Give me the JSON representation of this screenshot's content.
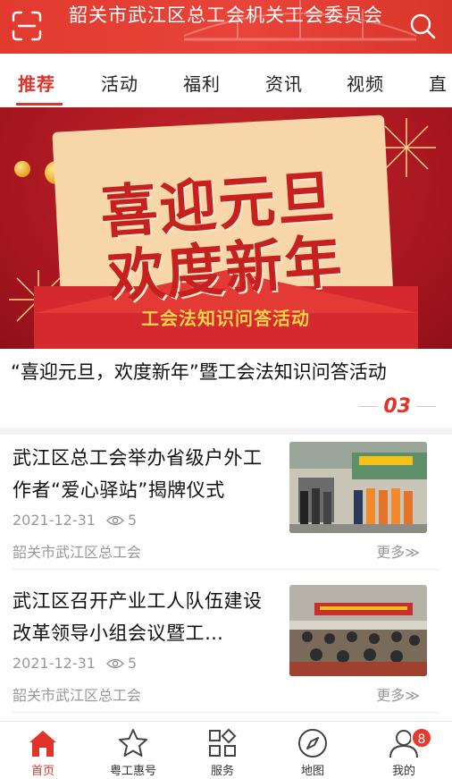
{
  "header": {
    "title": "韶关市武江区总工会机关工会委员会",
    "bg_color": "#e23a2e",
    "left_icon": "scan-icon",
    "right_icon": "search-icon"
  },
  "tabs": [
    {
      "label": "推荐",
      "active": true
    },
    {
      "label": "活动",
      "active": false
    },
    {
      "label": "福利",
      "active": false
    },
    {
      "label": "资讯",
      "active": false
    },
    {
      "label": "视频",
      "active": false
    },
    {
      "label": "直",
      "active": false
    }
  ],
  "banner": {
    "line1": "喜迎元旦",
    "line2": "欢度新年",
    "subtitle": "工会法知识问答活动",
    "caption": "“喜迎元旦，欢度新年”暨工会法知识问答活动",
    "page": "03"
  },
  "news": [
    {
      "title": "武江区总工会举办省级户外工作者“爱心驿站”揭牌仪式",
      "date": "2021-12-31",
      "views": "5",
      "source": "韶关市武江区总工会",
      "more": "更多"
    },
    {
      "title": "武江区召开产业工人队伍建设改革领导小组会议暨工…",
      "date": "2021-12-31",
      "views": "5",
      "source": "韶关市武江区总工会",
      "more": "更多"
    }
  ],
  "nav": [
    {
      "label": "首页",
      "icon": "home-icon",
      "active": true
    },
    {
      "label": "粤工惠号",
      "icon": "star-icon",
      "active": false
    },
    {
      "label": "服务",
      "icon": "grid-icon",
      "active": false
    },
    {
      "label": "地图",
      "icon": "compass-icon",
      "active": false
    },
    {
      "label": "我的",
      "icon": "user-icon",
      "active": false,
      "badge": "8"
    }
  ],
  "accent_color": "#e0332a"
}
